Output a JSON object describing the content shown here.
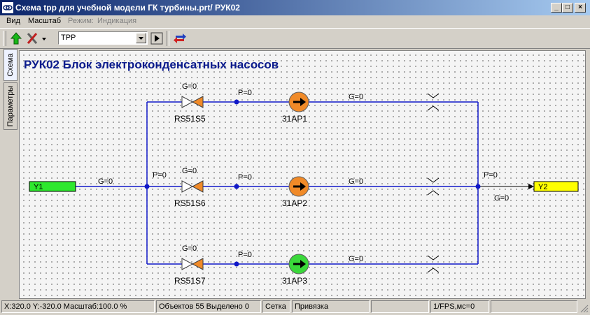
{
  "window": {
    "title": "Схема tpp для учебной модели ГК турбины.prt/ РУК02"
  },
  "menu": {
    "view": "Вид",
    "scale": "Масштаб",
    "mode": "Режим:",
    "indication": "Индикация"
  },
  "toolbar": {
    "combo_value": "TPP",
    "icons": [
      "arrow-up-green-icon",
      "tools-icon",
      "go-icon",
      "sync-icon"
    ]
  },
  "side_tabs": {
    "scheme": "Схема",
    "params": "Параметры"
  },
  "diagram": {
    "title": "РУК02 Блок электроконденсатных насосов",
    "inputs": {
      "left": "Y1",
      "right": "Y2"
    },
    "labels": {
      "g_in": "G=0",
      "p_left": "P=0",
      "p_right": "P=0",
      "g_out": "G=0"
    },
    "rows": [
      {
        "valve": "RS51S5",
        "valve_g": "G=0",
        "p": "P=0",
        "pump": "31AP1",
        "g": "G=0",
        "pump_color": "#f08a28"
      },
      {
        "valve": "RS51S6",
        "valve_g": "G=0",
        "p": "P=0",
        "pump": "31AP2",
        "g": "G=0",
        "pump_color": "#f08a28"
      },
      {
        "valve": "RS51S7",
        "valve_g": "G=0",
        "p": "P=0",
        "pump": "31AP3",
        "g": "G=0",
        "pump_color": "#3ad83a"
      }
    ],
    "colors": {
      "line": "#1018c8",
      "valve": "#f08a28",
      "y1": "#2ee82e",
      "y2": "#ffff00"
    }
  },
  "status": {
    "coords": "X:320.0  Y:-320.0  Масштаб:100.0 %",
    "objects": "Объектов 55  Выделено 0",
    "grid": "Сетка",
    "snap": "Привязка",
    "fps": "1/FPS,мс=0"
  }
}
